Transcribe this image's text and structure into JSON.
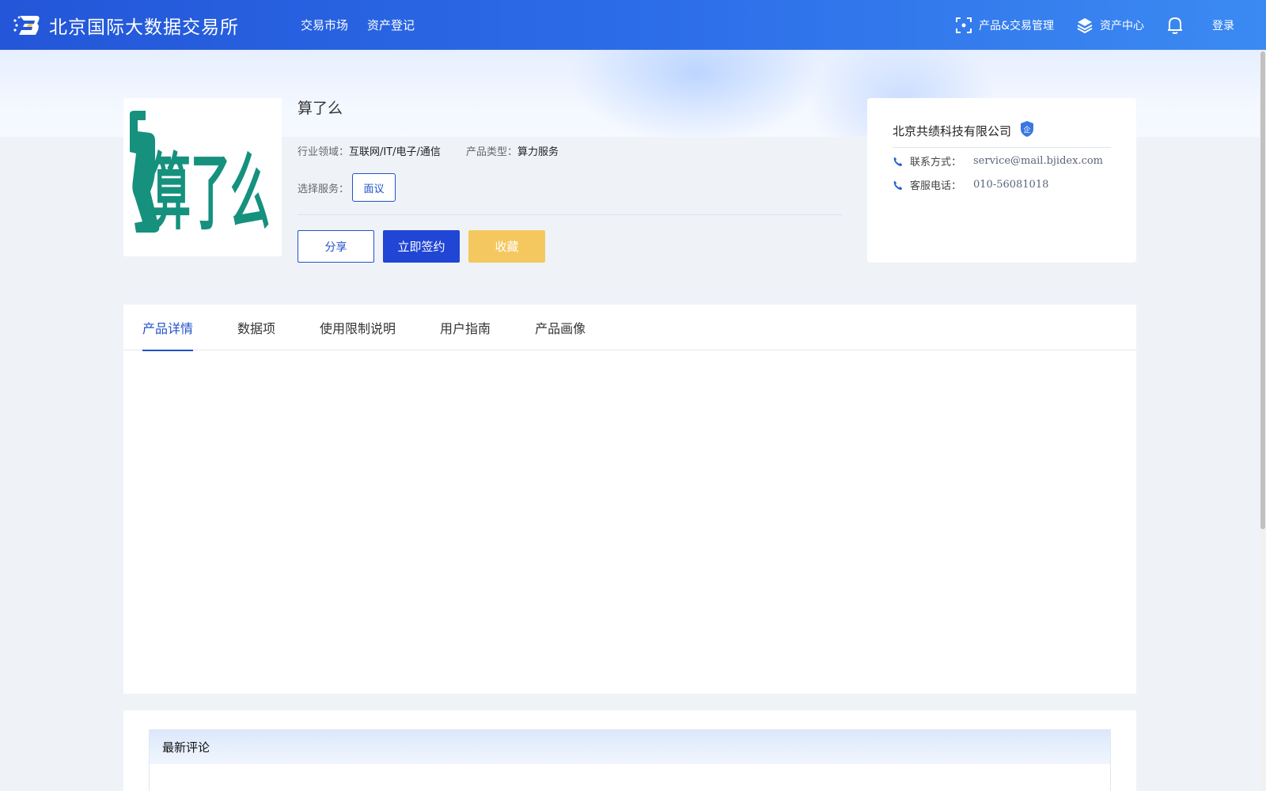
{
  "header": {
    "brand_name": "北京国际大数据交易所",
    "nav": [
      "交易市场",
      "资产登记"
    ],
    "right": {
      "product_mgmt": "产品&交易管理",
      "asset_center": "资产中心",
      "login": "登录"
    }
  },
  "product": {
    "title": "算了么",
    "logo_text": "算了么",
    "industry_label": "行业领域：",
    "industry_value": "互联网/IT/电子/通信",
    "type_label": "产品类型：",
    "type_value": "算力服务",
    "service_label": "选择服务：",
    "service_option": "面议",
    "buttons": {
      "share": "分享",
      "sign": "立即签约",
      "favorite": "收藏"
    }
  },
  "company": {
    "name": "北京共绩科技有限公司",
    "badge": "企",
    "contact_label": "联系方式：",
    "contact_value": "service@mail.bjidex.com",
    "phone_label": "客服电话：",
    "phone_value": "010-56081018"
  },
  "tabs": [
    "产品详情",
    "数据项",
    "使用限制说明",
    "用户指南",
    "产品画像"
  ],
  "active_tab": "产品详情",
  "comments": {
    "title": "最新评论"
  },
  "colors": {
    "primary": "#2252c9",
    "header": "#2c6ce8",
    "favorite": "#f4c85f",
    "logo_green": "#15917e"
  }
}
